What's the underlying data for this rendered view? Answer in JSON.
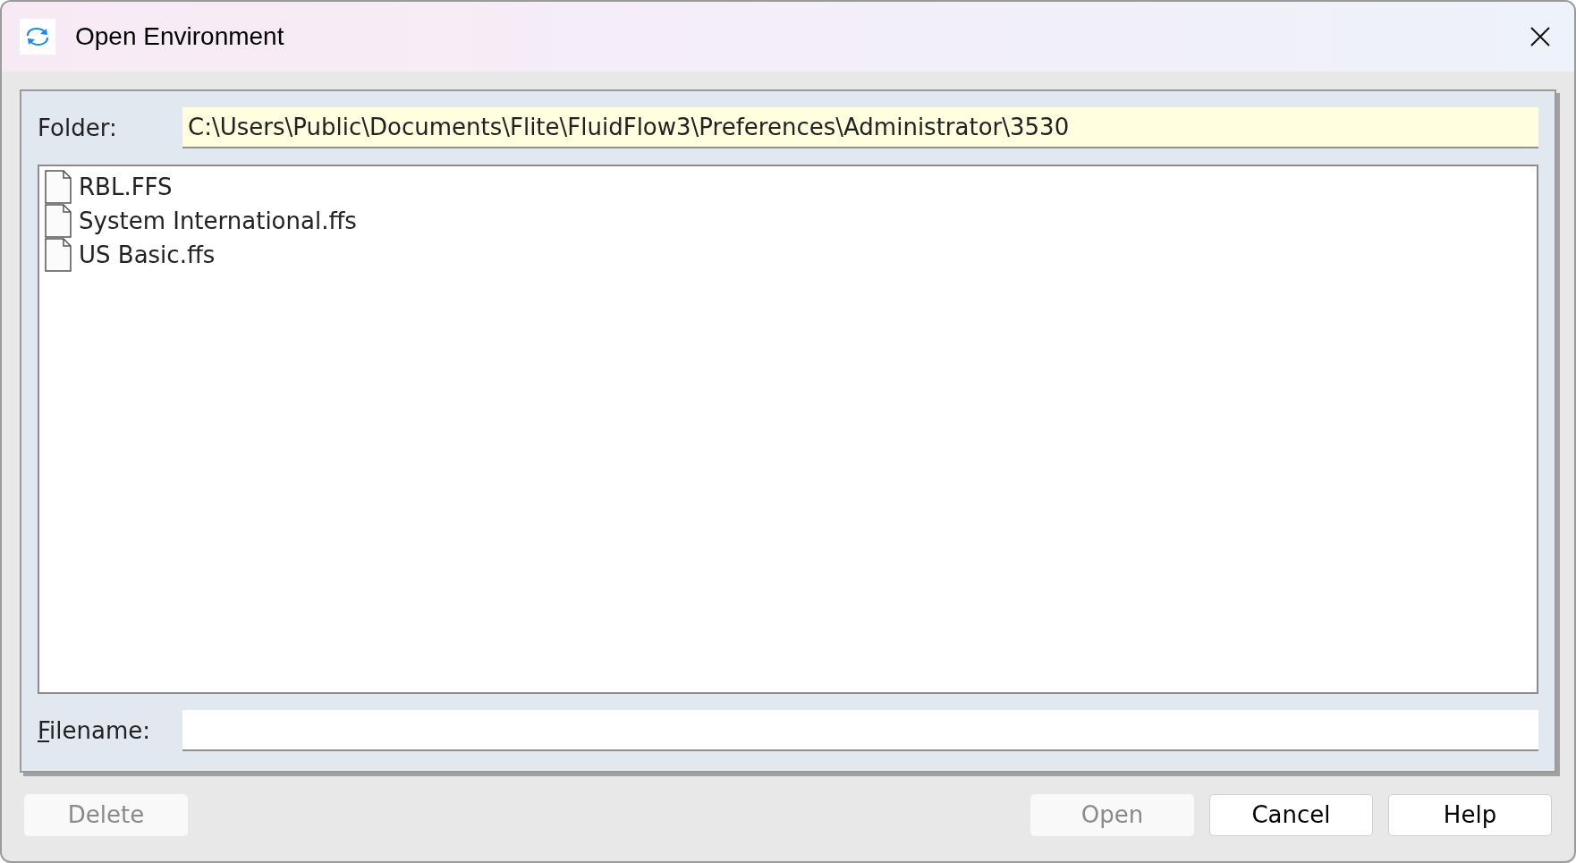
{
  "window": {
    "title": "Open Environment"
  },
  "folder": {
    "label": "Folder:",
    "value": "C:\\Users\\Public\\Documents\\Flite\\FluidFlow3\\Preferences\\Administrator\\3530"
  },
  "files": [
    {
      "name": "RBL.FFS"
    },
    {
      "name": "System International.ffs"
    },
    {
      "name": "US Basic.ffs"
    }
  ],
  "filename": {
    "label": "Filename:",
    "mnemonic": true
  },
  "left_buttons": [
    {
      "label": "Delete",
      "disabled": true
    }
  ],
  "right_buttons": [
    {
      "label": "Open",
      "disabled": true
    },
    {
      "label": "Cancel",
      "disabled": false
    },
    {
      "label": "Help",
      "disabled": false
    }
  ]
}
